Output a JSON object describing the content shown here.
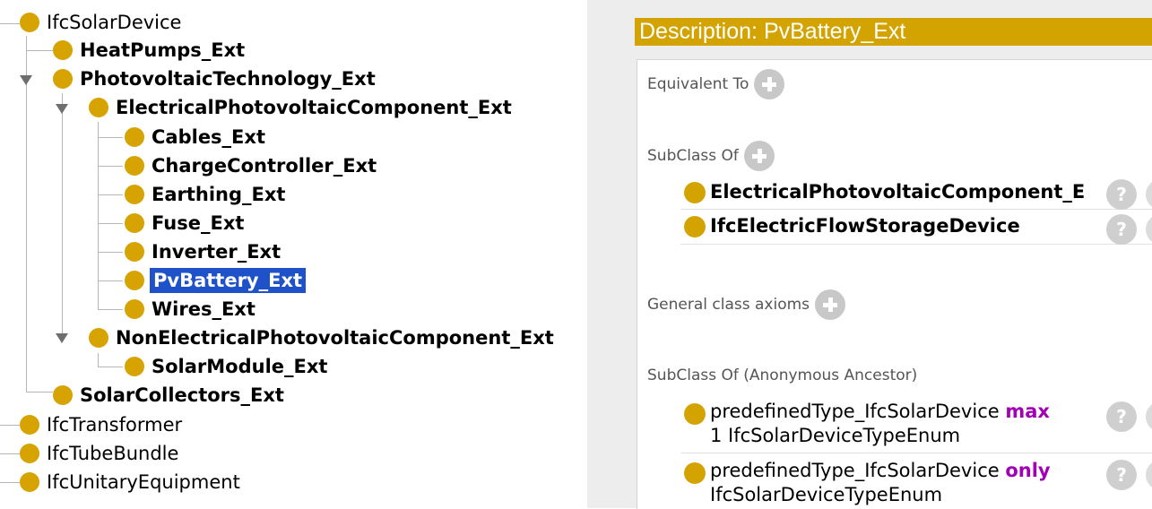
{
  "tree": {
    "items": [
      {
        "label": "IfcSolarDevice"
      },
      {
        "label": "HeatPumps_Ext"
      },
      {
        "label": "PhotovoltaicTechnology_Ext"
      },
      {
        "label": "ElectricalPhotovoltaicComponent_Ext"
      },
      {
        "label": "Cables_Ext"
      },
      {
        "label": "ChargeController_Ext"
      },
      {
        "label": "Earthing_Ext"
      },
      {
        "label": "Fuse_Ext"
      },
      {
        "label": "Inverter_Ext"
      },
      {
        "label": "PvBattery_Ext"
      },
      {
        "label": "Wires_Ext"
      },
      {
        "label": "NonElectricalPhotovoltaicComponent_Ext"
      },
      {
        "label": "SolarModule_Ext"
      },
      {
        "label": "SolarCollectors_Ext"
      },
      {
        "label": "IfcTransformer"
      },
      {
        "label": "IfcTubeBundle"
      },
      {
        "label": "IfcUnitaryEquipment"
      }
    ],
    "selected": "PvBattery_Ext"
  },
  "description": {
    "title": "Description: PvBattery_Ext",
    "sections": {
      "equivalent_to": "Equivalent To",
      "subclass_of": "SubClass Of",
      "general_class_axioms": "General class axioms",
      "anonymous_ancestor": "SubClass Of (Anonymous Ancestor)"
    },
    "subclass_of_items": [
      {
        "text": "ElectricalPhotovoltaicComponent_E"
      },
      {
        "text": "IfcElectricFlowStorageDevice"
      }
    ],
    "ancestor_items": [
      {
        "prefix": "predefinedType_IfcSolarDevice",
        "keyword": "max",
        "line2": "1 IfcSolarDeviceTypeEnum"
      },
      {
        "prefix": "predefinedType_IfcSolarDevice",
        "keyword": "only",
        "line2": "IfcSolarDeviceTypeEnum"
      }
    ],
    "help_glyph": "?"
  },
  "colors": {
    "class_dot": "#d6a301",
    "header_bg": "#d3a301",
    "selection_bg": "#1f51c8",
    "keyword": "#a200b4"
  }
}
